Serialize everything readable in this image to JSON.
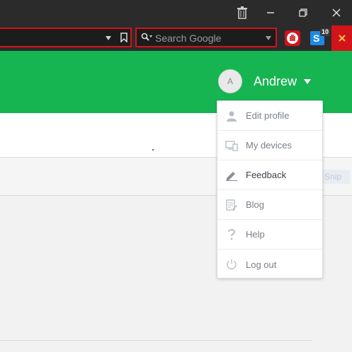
{
  "browser": {
    "search_placeholder": "Search Google",
    "extensions": [
      {
        "name": "stop-hand-extension"
      },
      {
        "name": "s-extension",
        "badge": "10"
      },
      {
        "name": "tools-extension"
      }
    ]
  },
  "header": {
    "avatar_initial": "A",
    "username": "Andrew",
    "brand_color": "#16b552"
  },
  "menu": {
    "items": [
      {
        "label": "Edit profile",
        "icon": "person-icon"
      },
      {
        "label": "My devices",
        "icon": "devices-icon"
      },
      {
        "label": "Feedback",
        "icon": "feedback-pen-icon"
      },
      {
        "label": "Blog",
        "icon": "blog-icon"
      },
      {
        "label": "Help",
        "icon": "help-icon"
      },
      {
        "label": "Log out",
        "icon": "power-icon"
      }
    ]
  },
  "overlay": {
    "ghost_text": "Rectangular Snip"
  }
}
